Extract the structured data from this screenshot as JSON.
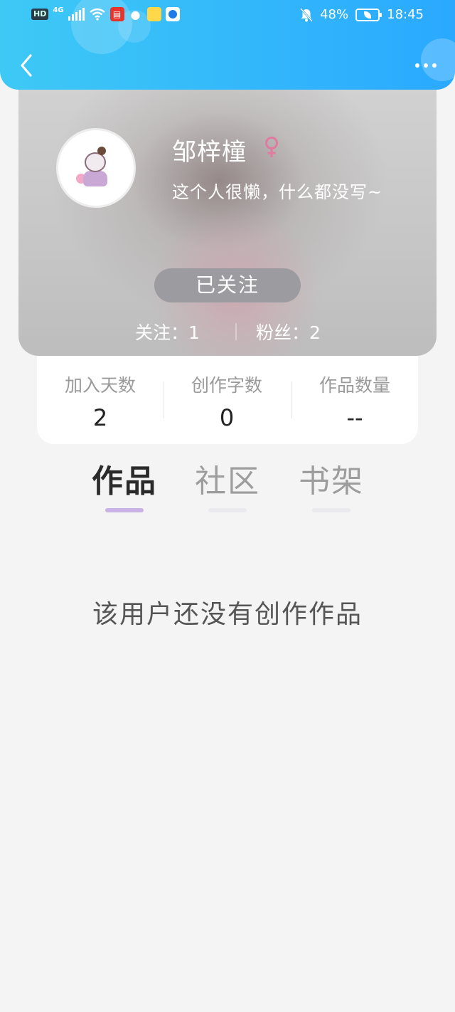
{
  "status_bar": {
    "hd": "HD",
    "network": "4G",
    "battery_percent": "48%",
    "time": "18:45"
  },
  "profile": {
    "name": "邹梓橦",
    "bio": "这个人很懒，什么都没写~",
    "follow_button_label": "已关注",
    "following_label": "关注：1",
    "fans_label": "粉丝：2"
  },
  "stats": [
    {
      "label": "加入天数",
      "value": "2"
    },
    {
      "label": "创作字数",
      "value": "0"
    },
    {
      "label": "作品数量",
      "value": "--"
    }
  ],
  "tabs": [
    {
      "label": "作品",
      "active": true
    },
    {
      "label": "社区",
      "active": false
    },
    {
      "label": "书架",
      "active": false
    }
  ],
  "empty_message": "该用户还没有创作作品",
  "colors": {
    "header_start": "#3ec9f5",
    "header_end": "#2aa9ff",
    "active_tab_indicator": "#c9b2e6",
    "gender_icon": "#e07aa0"
  },
  "icons": {
    "back": "chevron-left-icon",
    "more": "more-dots-icon",
    "gender": "female-icon"
  }
}
